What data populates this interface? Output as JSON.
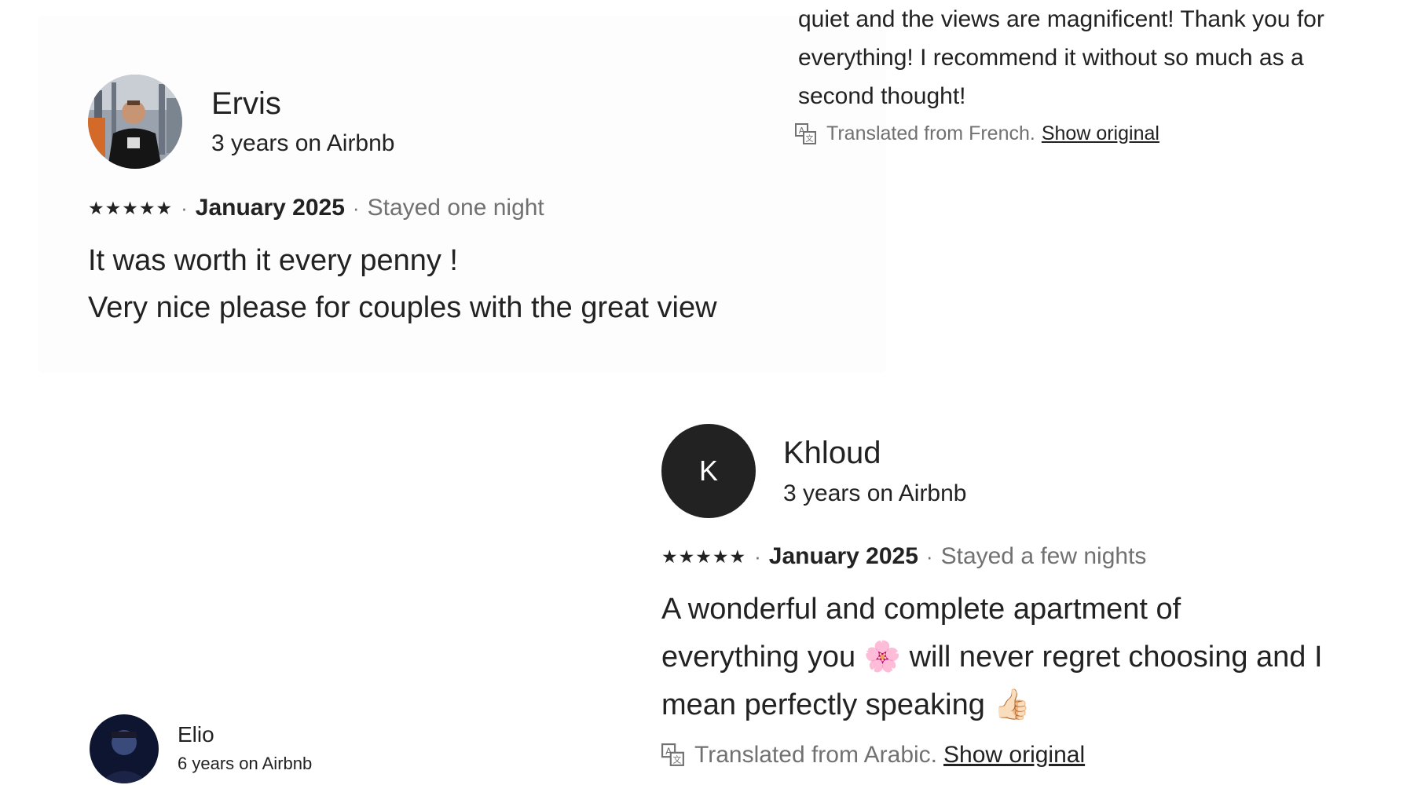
{
  "top_review_tail": {
    "lines": [
      "quiet and the views are magnificent! Thank you for",
      "everything! I recommend it without so much as a",
      "second thought!"
    ],
    "translated_label": "Translated from French.",
    "show_original_label": "Show original"
  },
  "review_ervis": {
    "name": "Ervis",
    "tenure": "3 years on Airbnb",
    "stars": "★★★★★",
    "separator": "·",
    "date": "January 2025",
    "stay": "Stayed one night",
    "lines": [
      "It was worth it every penny !",
      "Very nice please for couples with the great view"
    ]
  },
  "review_khloud": {
    "name": "Khloud",
    "avatar_letter": "K",
    "tenure": "3 years on Airbnb",
    "stars": "★★★★★",
    "separator": "·",
    "date": "January 2025",
    "stay": "Stayed a few nights",
    "line1": "A wonderful and complete apartment of",
    "line2_a": "everything you",
    "line2_emoji": "🌸",
    "line2_b": "will never regret choosing and I",
    "line3_a": "mean perfectly speaking",
    "line3_emoji": "👍🏻",
    "translated_label": "Translated from Arabic.",
    "show_original_label": "Show original"
  },
  "review_elio": {
    "name": "Elio",
    "tenure": "6 years on Airbnb"
  },
  "icons": {
    "star": "star-icon",
    "translate": "translate-icon"
  },
  "colors": {
    "text": "#222222",
    "secondary": "#717171",
    "avatar_dark": "#222222"
  }
}
